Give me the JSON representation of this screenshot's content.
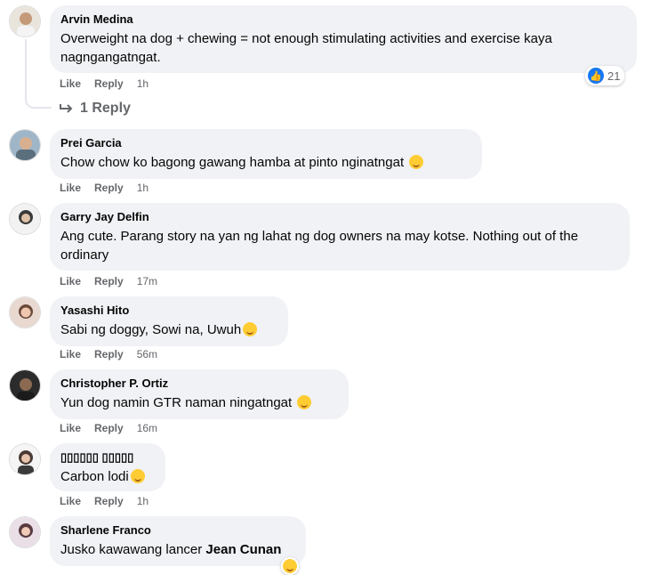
{
  "comments": [
    {
      "author": "Arvin Medina",
      "text": "Overweight na dog + chewing = not enough stimulating activities and exercise kaya nagngangatngat.",
      "like": "Like",
      "reply": "Reply",
      "time": "1h",
      "reactions": "21"
    },
    {
      "author": "Prei Garcia",
      "text": "Chow chow ko bagong gawang hamba at pinto nginatngat",
      "like": "Like",
      "reply": "Reply",
      "time": "1h"
    },
    {
      "author": "Garry Jay Delfin",
      "text": "Ang cute. Parang story na yan ng lahat ng dog owners na may kotse. Nothing out of the ordinary",
      "like": "Like",
      "reply": "Reply",
      "time": "17m"
    },
    {
      "author": "Yasashi Hito",
      "text": "Sabi ng doggy, Sowi na, Uwuh",
      "like": "Like",
      "reply": "Reply",
      "time": "56m"
    },
    {
      "author": "Christopher P. Ortiz",
      "text": "Yun dog namin GTR naman ningatngat",
      "like": "Like",
      "reply": "Reply",
      "time": "16m"
    },
    {
      "author": "▯▯▯▯▯▯ ▯▯▯▯▯",
      "text": "Carbon lodi",
      "like": "Like",
      "reply": "Reply",
      "time": "1h"
    },
    {
      "author": "Sharlene Franco",
      "text": "Jusko kawawang lancer ",
      "mention": "Jean Cunan"
    }
  ],
  "reply_link": "1 Reply",
  "icons": {
    "like_reaction": "thumbs-up-icon",
    "reply_arrow": "reply-arrow-icon",
    "emoji": "emoji-icon"
  },
  "colors": {
    "bubble": "#f0f2f5",
    "meta": "#65676b",
    "like_blue": "#1877f2"
  }
}
